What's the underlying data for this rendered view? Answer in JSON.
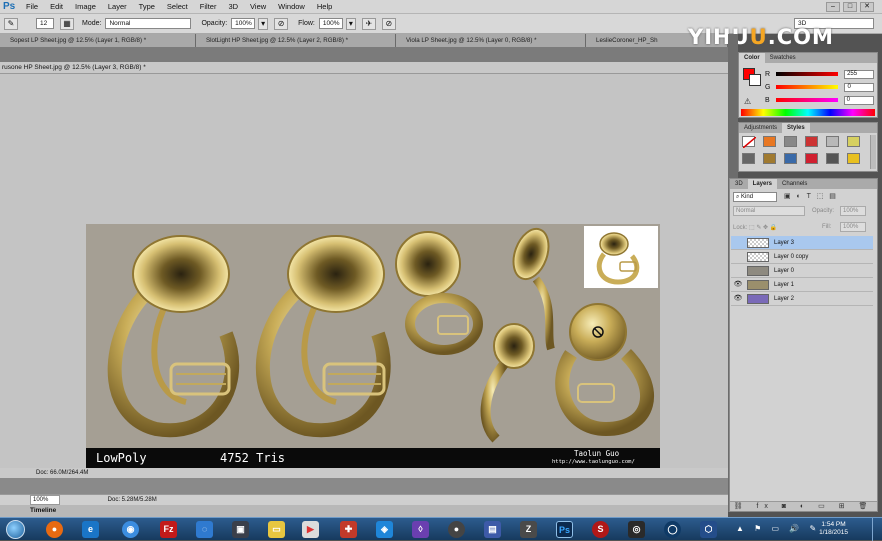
{
  "menubar": {
    "logo": "Ps",
    "items": [
      "File",
      "Edit",
      "Image",
      "Layer",
      "Type",
      "Select",
      "Filter",
      "3D",
      "View",
      "Window",
      "Help"
    ]
  },
  "options": {
    "brush_size": "12",
    "mode_label": "Mode:",
    "mode_value": "Normal",
    "opacity_label": "Opacity:",
    "opacity_value": "100%",
    "flow_label": "Flow:",
    "flow_value": "100%",
    "workspace": "3D"
  },
  "tabs": [
    "Sopest LP Sheet.jpg @ 12.5% (Layer 1, RGB/8) *",
    "SlotLight HP Sheet.jpg @ 12.5% (Layer 2, RGB/8) *",
    "Viola LP Sheet.jpg @ 12.5% (Layer 0, RGB/8) *",
    "LeslieCoroner_HP_Sh"
  ],
  "floating_title": "rusone HP Sheet.jpg @ 12.5% (Layer 3, RGB/8) *",
  "artwork": {
    "label_left": "LowPoly",
    "label_tris": "4752 Tris",
    "author": "Taolun Guo",
    "url": "http://www.taolunguo.com/"
  },
  "watermark": {
    "part1": "YIHU",
    "part2": "U",
    "part3": ".COM"
  },
  "status": {
    "doc1": "Doc: 66.0M/264.4M",
    "zoom": "100%",
    "doc2": "Doc: 5.28M/5.28M",
    "timeline": "Timeline"
  },
  "color_panel": {
    "tabs": [
      "Color",
      "Swatches"
    ],
    "r_label": "R",
    "g_label": "G",
    "b_label": "B",
    "r_value": "255",
    "g_value": "0",
    "b_value": "0",
    "foreground": "#ff0000"
  },
  "styles_panel": {
    "tabs": [
      "Adjustments",
      "Styles"
    ]
  },
  "layers_panel": {
    "tabs": [
      "3D",
      "Layers",
      "Channels"
    ],
    "kind": "Kind",
    "blend": "Normal",
    "opacity_label": "Opacity:",
    "opacity": "100%",
    "fill_label": "Fill:",
    "fill": "100%",
    "layers": [
      {
        "name": "Layer 3",
        "selected": true,
        "visible": false
      },
      {
        "name": "Layer 0 copy",
        "selected": false,
        "visible": false
      },
      {
        "name": "Layer 0",
        "selected": false,
        "visible": false
      },
      {
        "name": "Layer 1",
        "selected": false,
        "visible": true
      },
      {
        "name": "Layer 2",
        "selected": false,
        "visible": true
      }
    ]
  },
  "taskbar": {
    "time": "1:54 PM",
    "date": "1/18/2015"
  }
}
